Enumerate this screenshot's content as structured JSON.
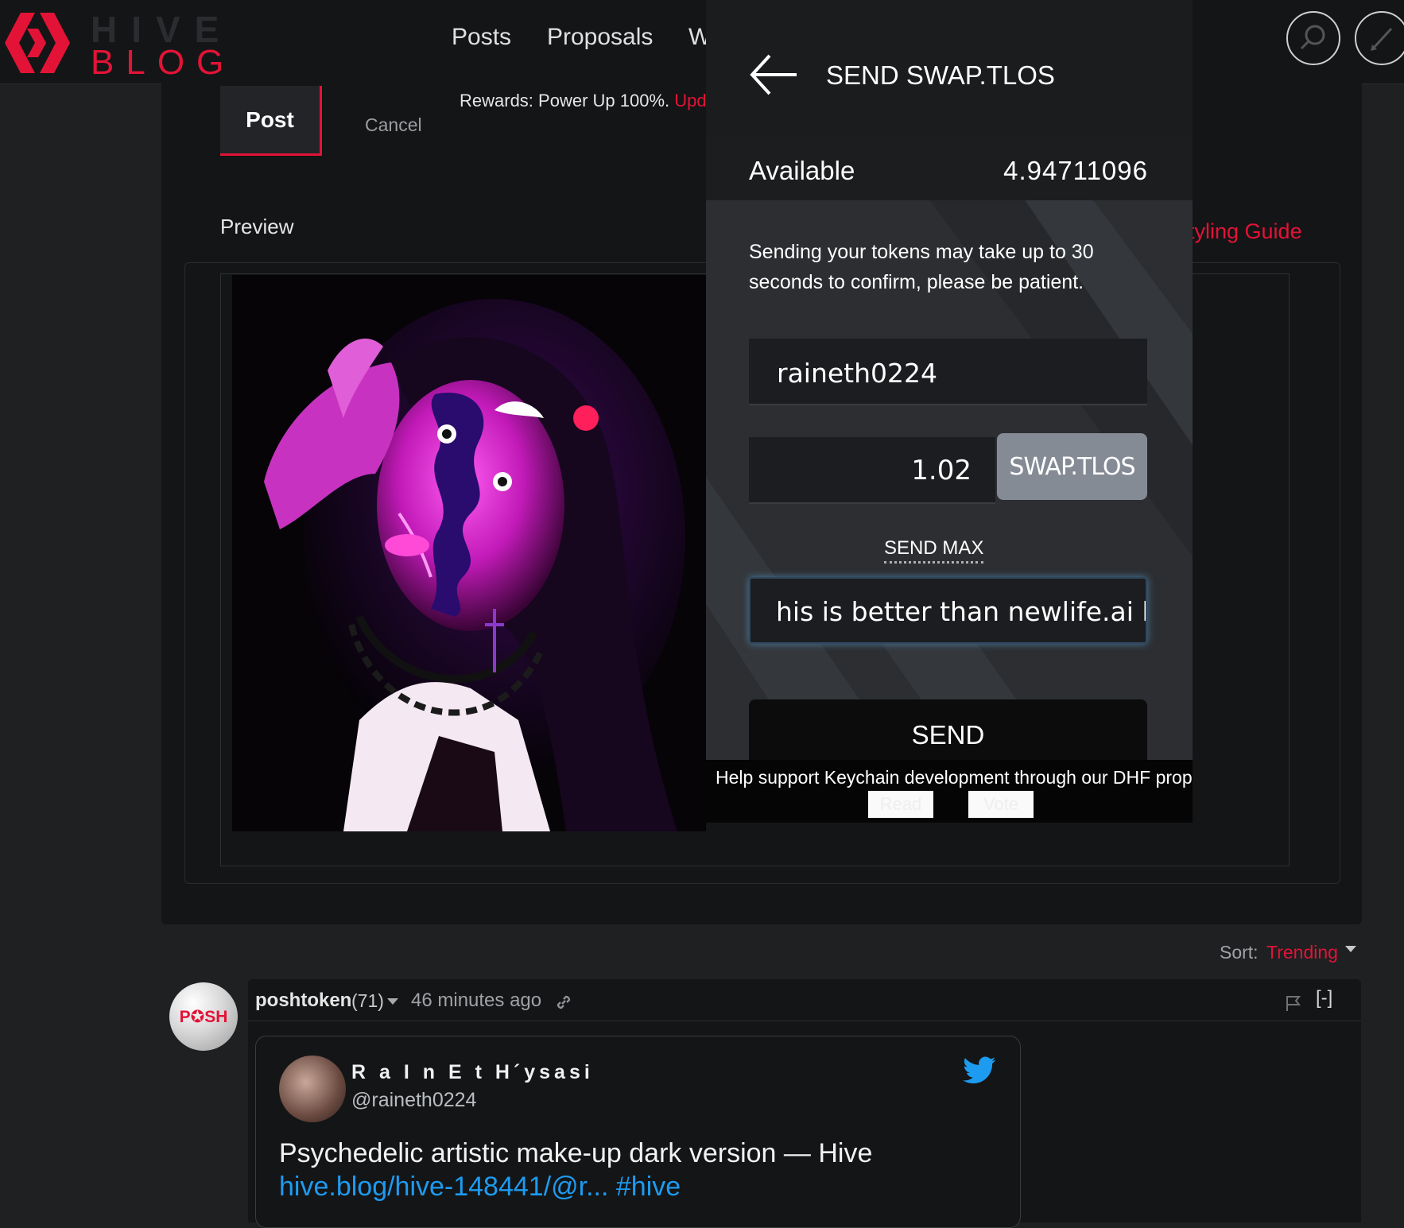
{
  "header": {
    "logo_hive": "HIVE",
    "logo_blog": "BLOG",
    "nav": [
      "Posts",
      "Proposals",
      "W"
    ]
  },
  "editor": {
    "post_label": "Post",
    "cancel_label": "Cancel",
    "rewards_text": "Rewards: Power Up 100%.",
    "rewards_update": "Upda",
    "preview_label": "Preview",
    "styling_guide": "tyling Guide"
  },
  "keychain": {
    "title": "SEND SWAP.TLOS",
    "available_label": "Available",
    "available_value": "4.94711096",
    "notice": "Sending your tokens may take up to 30 seconds to confirm, please be patient.",
    "recipient": "raineth0224",
    "amount": "1.02",
    "currency": "SWAP.TLOS",
    "send_max": "SEND MAX",
    "memo": "his is better than newlife.ai lol",
    "send": "SEND",
    "banner": "Help support Keychain development through our DHF proposal",
    "read": "Read",
    "vote": "Vote"
  },
  "comments": {
    "sort_label": "Sort:",
    "sort_value": "Trending",
    "avatar_text": "P✪SH",
    "author": "poshtoken",
    "reputation": "(71)",
    "time": "46 minutes ago",
    "collapse": "[-]"
  },
  "tweet": {
    "name": "R a I n E t H´ysasi",
    "handle": "@raineth0224",
    "text": "Psychedelic artistic make-up dark version — Hive",
    "link": "hive.blog/hive-148441/@r... #hive"
  },
  "colors": {
    "accent": "#e31337",
    "twitter": "#1d9bf0"
  }
}
